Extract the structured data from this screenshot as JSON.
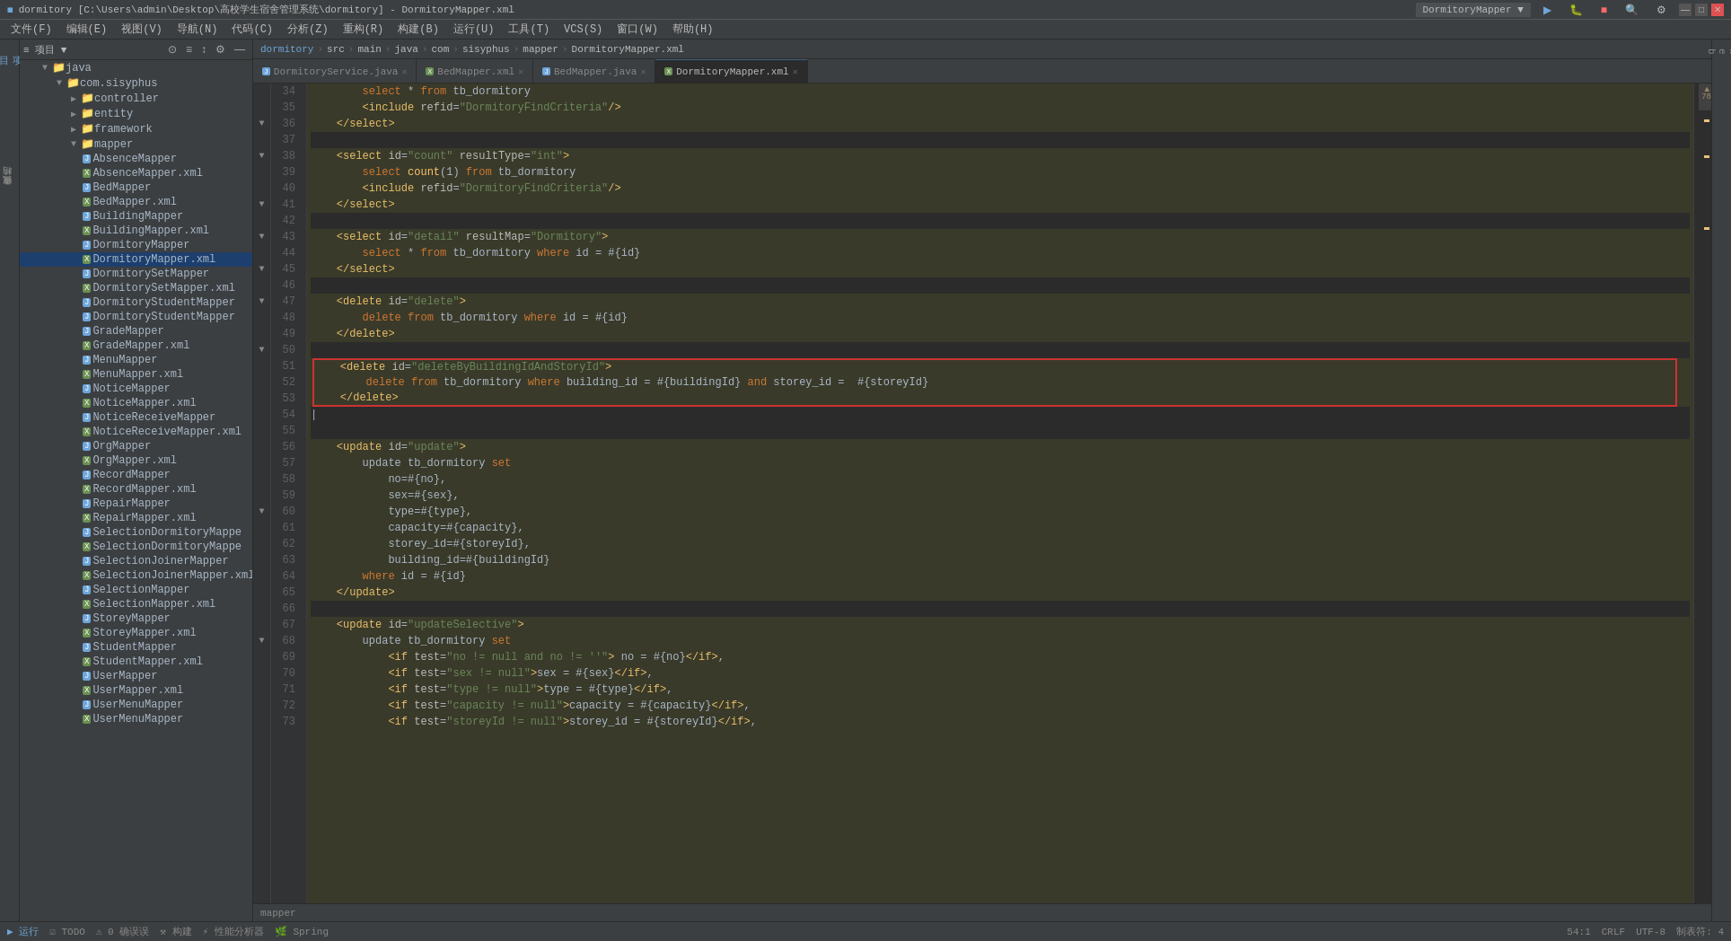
{
  "titleBar": {
    "title": "dormitory [C:\\Users\\admin\\Desktop\\高校学生宿舍管理系统\\dormitory] - DormitoryMapper.xml",
    "appName": "DormitoryMapper",
    "icon": "◼"
  },
  "menuBar": {
    "items": [
      "文件(F)",
      "编辑(E)",
      "视图(V)",
      "导航(N)",
      "代码(C)",
      "分析(Z)",
      "重构(R)",
      "构建(B)",
      "运行(U)",
      "工具(T)",
      "VCS(S)",
      "窗口(W)",
      "帮助(H)"
    ]
  },
  "breadcrumb": {
    "parts": [
      "dormitory",
      "src",
      "main",
      "java",
      "com",
      "sisyphus",
      "mapper",
      "DormitoryMapper.xml"
    ]
  },
  "sidebar": {
    "title": "项目",
    "tree": [
      {
        "level": 2,
        "type": "folder",
        "label": "java",
        "expanded": true
      },
      {
        "level": 3,
        "type": "folder",
        "label": "com.sisyphus",
        "expanded": true
      },
      {
        "level": 4,
        "type": "folder",
        "label": "controller",
        "expanded": false
      },
      {
        "level": 4,
        "type": "folder",
        "label": "entity",
        "expanded": false
      },
      {
        "level": 4,
        "type": "folder",
        "label": "framework",
        "expanded": false
      },
      {
        "level": 4,
        "type": "folder",
        "label": "mapper",
        "expanded": true
      },
      {
        "level": 5,
        "type": "java",
        "label": "AbsenceMapper"
      },
      {
        "level": 5,
        "type": "xml",
        "label": "AbsenceMapper.xml"
      },
      {
        "level": 5,
        "type": "java",
        "label": "BedMapper"
      },
      {
        "level": 5,
        "type": "xml",
        "label": "BedMapper.xml"
      },
      {
        "level": 5,
        "type": "java",
        "label": "BuildingMapper"
      },
      {
        "level": 5,
        "type": "xml",
        "label": "BuildingMapper.xml"
      },
      {
        "level": 5,
        "type": "java",
        "label": "DormitoryMapper"
      },
      {
        "level": 5,
        "type": "xml",
        "label": "DormitoryMapper.xml",
        "active": true
      },
      {
        "level": 5,
        "type": "java",
        "label": "DormitorySetMapper"
      },
      {
        "level": 5,
        "type": "xml",
        "label": "DormitorySetMapper.xml"
      },
      {
        "level": 5,
        "type": "java",
        "label": "DormitoryStudentMapper"
      },
      {
        "level": 5,
        "type": "xml",
        "label": "DormitoryStudentMapper"
      },
      {
        "level": 5,
        "type": "java",
        "label": "GradeMapper"
      },
      {
        "level": 5,
        "type": "xml",
        "label": "GradeMapper.xml"
      },
      {
        "level": 5,
        "type": "java",
        "label": "MenuMapper"
      },
      {
        "level": 5,
        "type": "xml",
        "label": "MenuMapper.xml"
      },
      {
        "level": 5,
        "type": "java",
        "label": "NoticeMapper"
      },
      {
        "level": 5,
        "type": "xml",
        "label": "NoticeMapper.xml"
      },
      {
        "level": 5,
        "type": "java",
        "label": "NoticeReceiveMapper"
      },
      {
        "level": 5,
        "type": "xml",
        "label": "NoticeReceiveMapper.xml"
      },
      {
        "level": 5,
        "type": "java",
        "label": "OrgMapper"
      },
      {
        "level": 5,
        "type": "xml",
        "label": "OrgMapper.xml"
      },
      {
        "level": 5,
        "type": "java",
        "label": "RecordMapper"
      },
      {
        "level": 5,
        "type": "xml",
        "label": "RecordMapper.xml"
      },
      {
        "level": 5,
        "type": "java",
        "label": "RepairMapper"
      },
      {
        "level": 5,
        "type": "xml",
        "label": "RepairMapper.xml"
      },
      {
        "level": 5,
        "type": "java",
        "label": "SelectionDormitoryMappe"
      },
      {
        "level": 5,
        "type": "xml",
        "label": "SelectionDormitoryMappe"
      },
      {
        "level": 5,
        "type": "java",
        "label": "SelectionJoinerMapper"
      },
      {
        "level": 5,
        "type": "xml",
        "label": "SelectionJoinerMapper.xml"
      },
      {
        "level": 5,
        "type": "java",
        "label": "SelectionMapper"
      },
      {
        "level": 5,
        "type": "xml",
        "label": "SelectionMapper.xml"
      },
      {
        "level": 5,
        "type": "java",
        "label": "StoreyMapper"
      },
      {
        "level": 5,
        "type": "xml",
        "label": "StoreyMapper.xml"
      },
      {
        "level": 5,
        "type": "java",
        "label": "StudentMapper"
      },
      {
        "level": 5,
        "type": "xml",
        "label": "StudentMapper.xml"
      },
      {
        "level": 5,
        "type": "java",
        "label": "UserMapper"
      },
      {
        "level": 5,
        "type": "xml",
        "label": "UserMapper.xml"
      },
      {
        "level": 5,
        "type": "java",
        "label": "UserMenuMapper"
      },
      {
        "level": 5,
        "type": "xml",
        "label": "UserMenuMapper"
      }
    ]
  },
  "tabs": [
    {
      "label": "DormitoryService.java",
      "type": "java",
      "active": false
    },
    {
      "label": "BedMapper.xml",
      "type": "xml",
      "active": false
    },
    {
      "label": "BedMapper.java",
      "type": "java",
      "active": false
    },
    {
      "label": "DormitoryMapper.xml",
      "type": "xml",
      "active": true
    }
  ],
  "codeLines": [
    {
      "num": 34,
      "content": "        select * from tb_dormitory",
      "highlight": true
    },
    {
      "num": 35,
      "content": "        <include refid=\"DormitoryFindCriteria\"/>",
      "highlight": true
    },
    {
      "num": 36,
      "content": "    </select>",
      "highlight": true
    },
    {
      "num": 37,
      "content": "",
      "highlight": false
    },
    {
      "num": 38,
      "content": "    <select id=\"count\" resultType=\"int\">",
      "highlight": true
    },
    {
      "num": 39,
      "content": "        select count(1) from tb_dormitory",
      "highlight": true
    },
    {
      "num": 40,
      "content": "        <include refid=\"DormitoryFindCriteria\"/>",
      "highlight": true
    },
    {
      "num": 41,
      "content": "    </select>",
      "highlight": true
    },
    {
      "num": 42,
      "content": "",
      "highlight": false
    },
    {
      "num": 43,
      "content": "    <select id=\"detail\" resultMap=\"Dormitory\">",
      "highlight": true
    },
    {
      "num": 44,
      "content": "        select * from tb_dormitory where id = #{id}",
      "highlight": true
    },
    {
      "num": 45,
      "content": "    </select>",
      "highlight": true
    },
    {
      "num": 46,
      "content": "",
      "highlight": false
    },
    {
      "num": 47,
      "content": "    <delete id=\"delete\">",
      "highlight": true
    },
    {
      "num": 48,
      "content": "        delete from tb_dormitory where id = #{id}",
      "highlight": true
    },
    {
      "num": 49,
      "content": "    </delete>",
      "highlight": true
    },
    {
      "num": 50,
      "content": "",
      "highlight": false
    },
    {
      "num": 51,
      "content": "    <delete id=\"deleteByBuildingIdAndStoryId\">",
      "highlight": true,
      "redbox": "top"
    },
    {
      "num": 52,
      "content": "        delete from tb_dormitory where building_id = #{buildingId} and storey_id =  #{storeyId}",
      "highlight": true,
      "redbox": "mid"
    },
    {
      "num": 53,
      "content": "    </delete>",
      "highlight": true,
      "redbox": "bot"
    },
    {
      "num": 54,
      "content": "",
      "highlight": false
    },
    {
      "num": 55,
      "content": "",
      "highlight": false
    },
    {
      "num": 56,
      "content": "    <update id=\"update\">",
      "highlight": true
    },
    {
      "num": 57,
      "content": "        update tb_dormitory set",
      "highlight": true
    },
    {
      "num": 58,
      "content": "            no=#{no},",
      "highlight": true
    },
    {
      "num": 59,
      "content": "            sex=#{sex},",
      "highlight": true
    },
    {
      "num": 60,
      "content": "            type=#{type},",
      "highlight": true
    },
    {
      "num": 61,
      "content": "            capacity=#{capacity},",
      "highlight": true
    },
    {
      "num": 62,
      "content": "            storey_id=#{storeyId},",
      "highlight": true
    },
    {
      "num": 63,
      "content": "            building_id=#{buildingId}",
      "highlight": true
    },
    {
      "num": 64,
      "content": "        where id = #{id}",
      "highlight": true
    },
    {
      "num": 65,
      "content": "    </update>",
      "highlight": true
    },
    {
      "num": 66,
      "content": "",
      "highlight": false
    },
    {
      "num": 67,
      "content": "    <update id=\"updateSelective\">",
      "highlight": true
    },
    {
      "num": 68,
      "content": "        update tb_dormitory set",
      "highlight": true
    },
    {
      "num": 69,
      "content": "            <if test=\"no != null and no != ''\"> no = #{no}</if>,",
      "highlight": true
    },
    {
      "num": 70,
      "content": "            <if test=\"sex != null\">sex = #{sex}</if>,",
      "highlight": true
    },
    {
      "num": 71,
      "content": "            <if test=\"type != null\">type = #{type}</if>,",
      "highlight": true
    },
    {
      "num": 72,
      "content": "            <if test=\"capacity != null\">capacity = #{capacity}</if>,",
      "highlight": true
    },
    {
      "num": 73,
      "content": "            <if test=\"storeyId != null\">storey_id = #{storeyId}</if>,",
      "highlight": true
    }
  ],
  "statusBar": {
    "run": "▶ 运行",
    "todo": "☑ TODO",
    "problems": "⚠ 0  确误误",
    "build": "⚒ 构建",
    "profile": "⚡ 性能分析器",
    "spring": "🌿 Spring",
    "rightItems": [
      "54:1",
      "CRLF",
      "UTF-8",
      "制表符: 4"
    ],
    "warningCount": "▲ 78",
    "cursorPos": "54:1",
    "lineEnding": "CRLF",
    "encoding": "UTF-8",
    "indent": "制表符: 4",
    "bottomFile": "mapper"
  },
  "bottomInfo": "mapper"
}
